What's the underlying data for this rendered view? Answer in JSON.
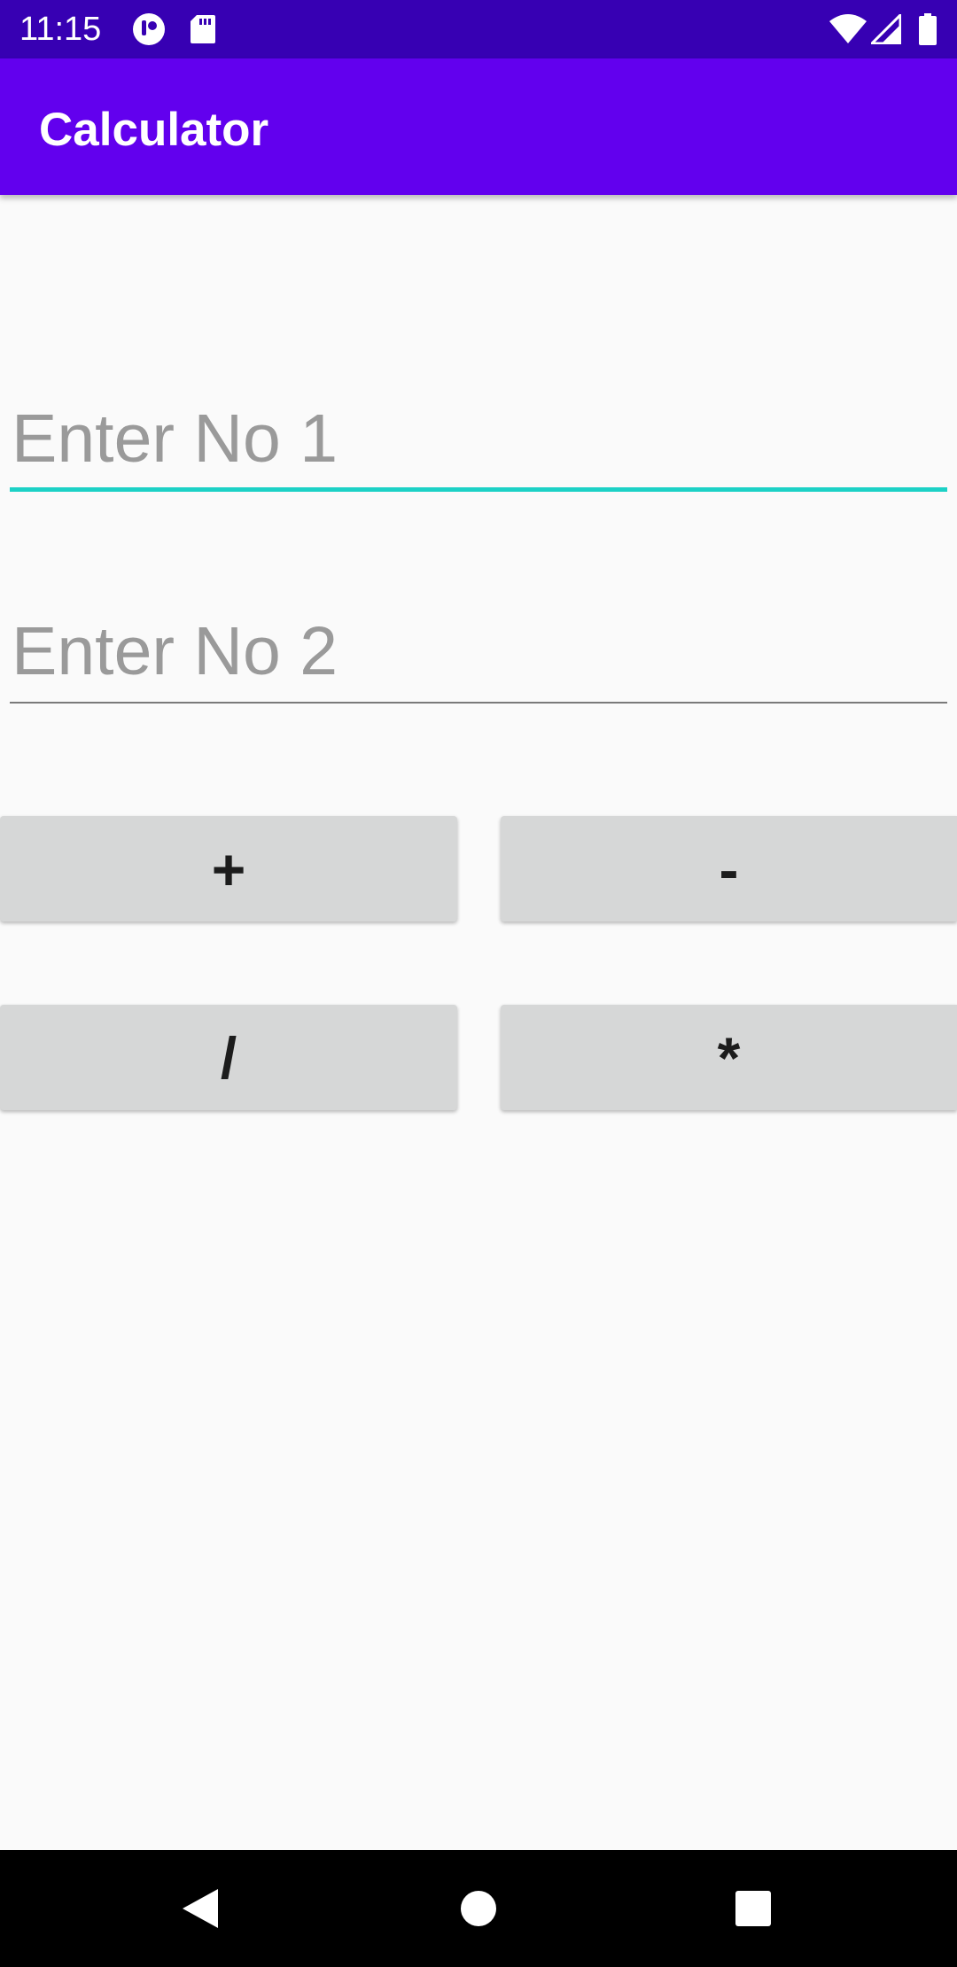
{
  "status_bar": {
    "time": "11:15",
    "icons": [
      "notification-app-icon",
      "sd-card-icon",
      "wifi-icon",
      "cellular-signal-icon",
      "battery-icon"
    ]
  },
  "app_bar": {
    "title": "Calculator",
    "color": "#6200ee"
  },
  "inputs": {
    "first": {
      "value": "",
      "placeholder": "Enter No 1",
      "focused": true
    },
    "second": {
      "value": "",
      "placeholder": "Enter No 2",
      "focused": false
    }
  },
  "buttons": {
    "add": "+",
    "subtract": "-",
    "divide": "/",
    "multiply": "*"
  },
  "nav_bar": {
    "icons": [
      "back-icon",
      "home-icon",
      "recents-icon"
    ]
  },
  "colors": {
    "status_bar": "#3700b3",
    "app_bar": "#6200ee",
    "focus_accent": "#1cd1c6",
    "button_bg": "#d6d7d7",
    "background": "#fafafa"
  }
}
